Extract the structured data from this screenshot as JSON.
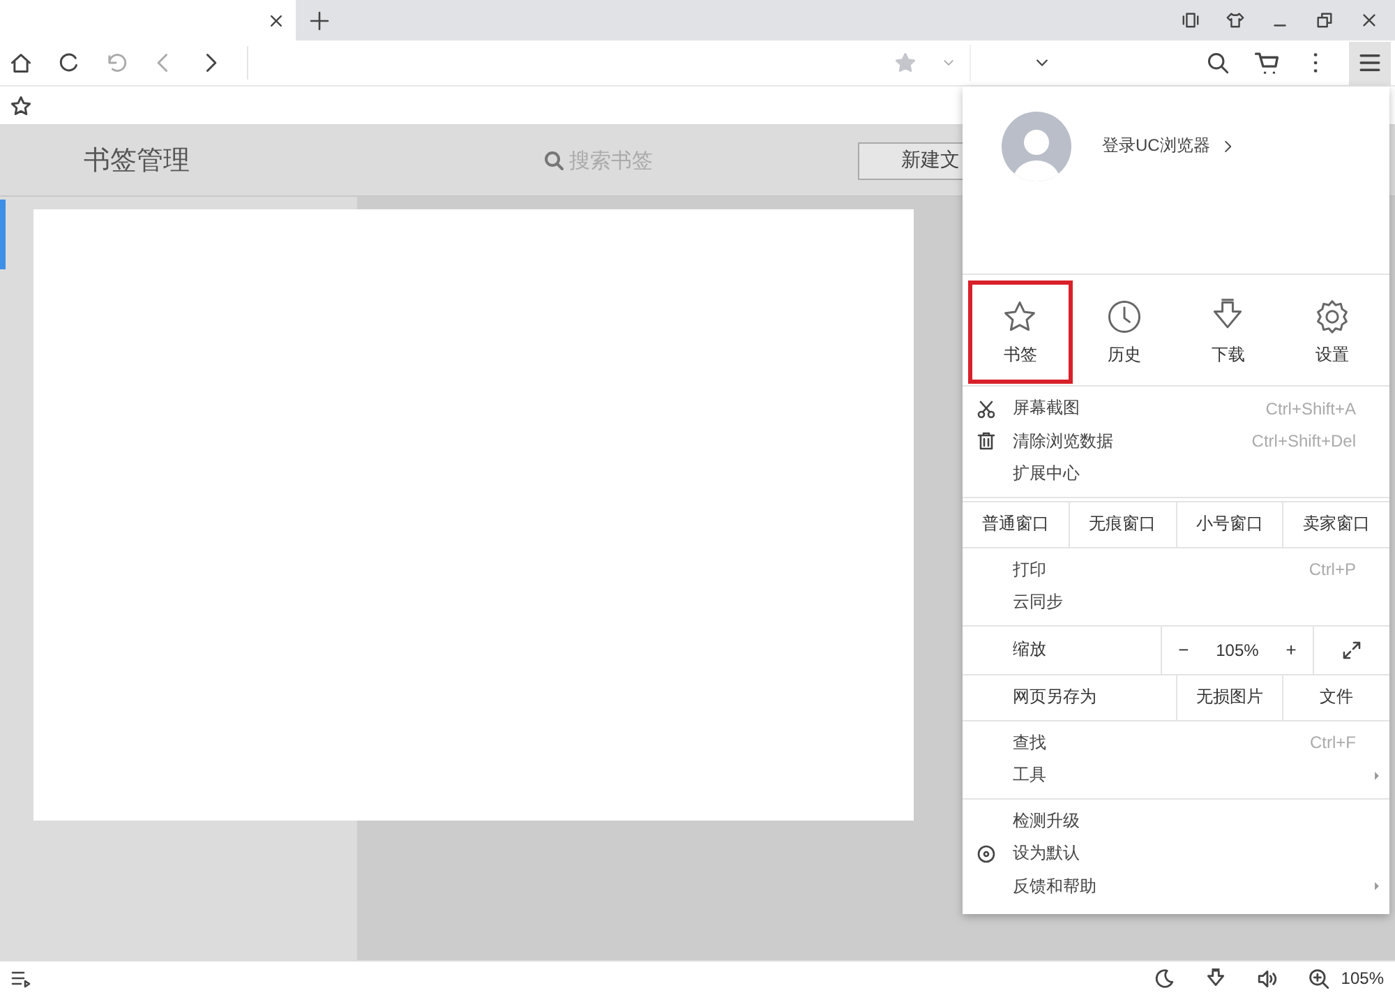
{
  "bookmark_page": {
    "title": "书签管理",
    "search": {
      "placeholder": "搜索书签"
    },
    "new_button": "新建文"
  },
  "menu": {
    "login": "登录UC浏览器",
    "quick": [
      {
        "label": "书签",
        "kind": "star",
        "selected": true
      },
      {
        "label": "历史",
        "kind": "clock",
        "selected": false
      },
      {
        "label": "下载",
        "kind": "download",
        "selected": false
      },
      {
        "label": "设置",
        "kind": "gear",
        "selected": false
      }
    ],
    "tools": [
      {
        "label": "屏幕截图",
        "shortcut": "Ctrl+Shift+A",
        "kind": "scissors"
      },
      {
        "label": "清除浏览数据",
        "shortcut": "Ctrl+Shift+Del",
        "kind": "trash"
      },
      {
        "label": "扩展中心"
      }
    ],
    "windows": [
      "普通窗口",
      "无痕窗口",
      "小号窗口",
      "卖家窗口"
    ],
    "print": [
      {
        "label": "打印",
        "shortcut": "Ctrl+P"
      },
      {
        "label": "云同步"
      }
    ],
    "zoom": {
      "label": "缩放",
      "minus": "−",
      "value": "105%",
      "plus": "+"
    },
    "save": {
      "label": "网页另存为",
      "options": [
        "无损图片",
        "文件"
      ]
    },
    "find": [
      {
        "label": "查找",
        "shortcut": "Ctrl+F",
        "submenu": false
      },
      {
        "label": "工具",
        "submenu": true
      }
    ],
    "misc": [
      {
        "label": "检测升级",
        "submenu": false
      },
      {
        "label": "设为默认",
        "kind": "target",
        "submenu": false
      },
      {
        "label": "反馈和帮助",
        "submenu": true
      }
    ]
  },
  "status_bar": {
    "zoom": "105%"
  }
}
